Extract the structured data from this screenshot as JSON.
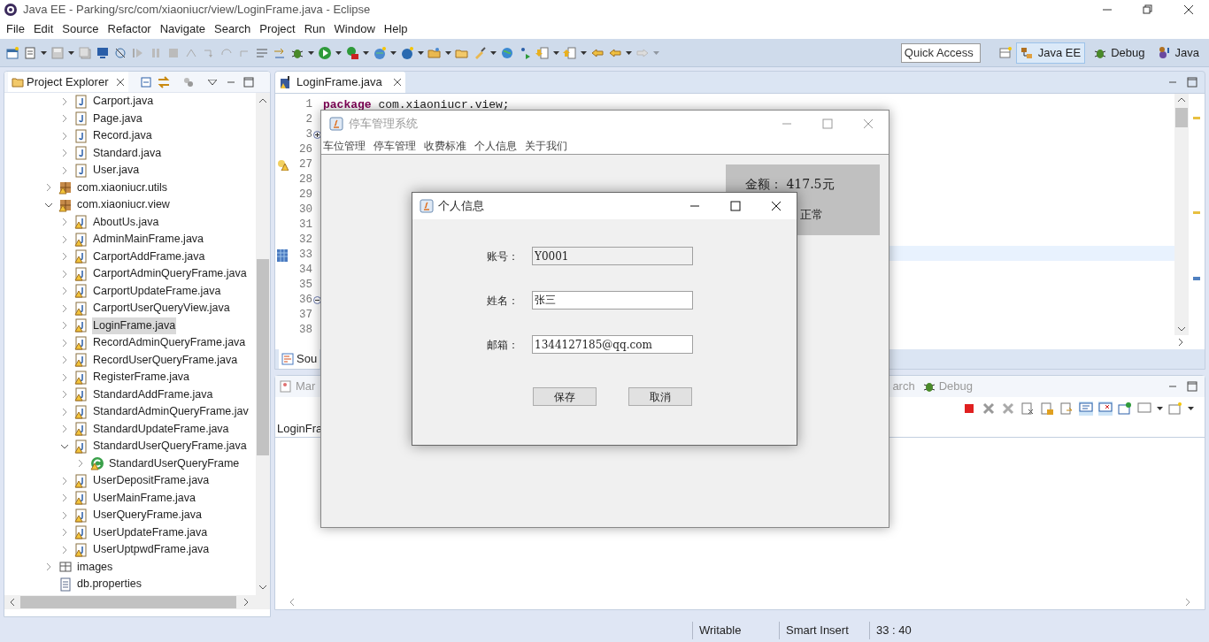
{
  "window": {
    "title": "Java EE - Parking/src/com/xiaoniucr/view/LoginFrame.java - Eclipse"
  },
  "menu_bar": [
    "File",
    "Edit",
    "Source",
    "Refactor",
    "Navigate",
    "Search",
    "Project",
    "Run",
    "Window",
    "Help"
  ],
  "toolbar": {
    "quick_access": {
      "placeholder": "Quick Access"
    },
    "perspectives": [
      {
        "label": "Java EE",
        "selected": true,
        "kind": "javaee"
      },
      {
        "label": "Debug",
        "selected": false,
        "kind": "debug"
      },
      {
        "label": "Java",
        "selected": false,
        "kind": "java"
      }
    ]
  },
  "project_explorer": {
    "title": "Project Explorer",
    "tree": [
      {
        "children": [
          {
            "label": "Carport.java",
            "kind": "java",
            "warning": false,
            "expanded": false,
            "selected": false
          },
          {
            "label": "Page.java",
            "kind": "java",
            "warning": false,
            "expanded": false,
            "selected": false
          },
          {
            "label": "Record.java",
            "kind": "java",
            "warning": false,
            "expanded": false,
            "selected": false
          },
          {
            "label": "Standard.java",
            "kind": "java",
            "warning": false,
            "expanded": false,
            "selected": false
          },
          {
            "label": "User.java",
            "kind": "java",
            "warning": false,
            "expanded": false,
            "selected": false
          }
        ]
      },
      {
        "label": "com.xiaoniucr.utils",
        "kind": "package",
        "warning": true,
        "expanded": false,
        "selected": false
      },
      {
        "label": "com.xiaoniucr.view",
        "kind": "package",
        "warning": true,
        "expanded": true,
        "selected": false,
        "children": [
          {
            "label": "AboutUs.java",
            "kind": "java",
            "warning": true,
            "expanded": false,
            "selected": false
          },
          {
            "label": "AdminMainFrame.java",
            "kind": "java",
            "warning": true,
            "expanded": false,
            "selected": false
          },
          {
            "label": "CarportAddFrame.java",
            "kind": "java",
            "warning": true,
            "expanded": false,
            "selected": false
          },
          {
            "label": "CarportAdminQueryFrame.java",
            "kind": "java",
            "warning": true,
            "expanded": false,
            "selected": false
          },
          {
            "label": "CarportUpdateFrame.java",
            "kind": "java",
            "warning": true,
            "expanded": false,
            "selected": false
          },
          {
            "label": "CarportUserQueryView.java",
            "kind": "java",
            "warning": true,
            "expanded": false,
            "selected": false
          },
          {
            "label": "LoginFrame.java",
            "kind": "java",
            "warning": true,
            "expanded": false,
            "selected": true
          },
          {
            "label": "RecordAdminQueryFrame.java",
            "kind": "java",
            "warning": true,
            "expanded": false,
            "selected": false
          },
          {
            "label": "RecordUserQueryFrame.java",
            "kind": "java",
            "warning": true,
            "expanded": false,
            "selected": false
          },
          {
            "label": "RegisterFrame.java",
            "kind": "java",
            "warning": true,
            "expanded": false,
            "selected": false
          },
          {
            "label": "StandardAddFrame.java",
            "kind": "java",
            "warning": true,
            "expanded": false,
            "selected": false
          },
          {
            "label": "StandardAdminQueryFrame.jav",
            "kind": "java",
            "warning": true,
            "expanded": false,
            "selected": false
          },
          {
            "label": "StandardUpdateFrame.java",
            "kind": "java",
            "warning": true,
            "expanded": false,
            "selected": false
          },
          {
            "label": "StandardUserQueryFrame.java",
            "kind": "java",
            "warning": true,
            "expanded": true,
            "selected": false,
            "children": [
              {
                "label": "StandardUserQueryFrame",
                "kind": "class",
                "warning": true,
                "expanded": false,
                "selected": false
              }
            ]
          },
          {
            "label": "UserDepositFrame.java",
            "kind": "java",
            "warning": true,
            "expanded": false,
            "selected": false
          },
          {
            "label": "UserMainFrame.java",
            "kind": "java",
            "warning": true,
            "expanded": false,
            "selected": false
          },
          {
            "label": "UserQueryFrame.java",
            "kind": "java",
            "warning": true,
            "expanded": false,
            "selected": false
          },
          {
            "label": "UserUpdateFrame.java",
            "kind": "java",
            "warning": true,
            "expanded": false,
            "selected": false
          },
          {
            "label": "UserUptpwdFrame.java",
            "kind": "java",
            "warning": true,
            "expanded": false,
            "selected": false
          }
        ]
      },
      {
        "label": "images",
        "kind": "folder",
        "warning": false,
        "expanded": false,
        "selected": false
      },
      {
        "label": "db.properties",
        "kind": "file",
        "warning": false,
        "selected": false
      }
    ]
  },
  "editor": {
    "tab": "LoginFrame.java",
    "lines": [
      {
        "number": "1",
        "code_keyword": "package",
        "code": " com.xiaoniucr.view;"
      },
      {
        "number": "2"
      },
      {
        "number": "3",
        "foldable": true,
        "folded": true
      },
      {
        "number": "26"
      },
      {
        "number": "27",
        "warning": true
      },
      {
        "number": "28"
      },
      {
        "number": "29"
      },
      {
        "number": "30"
      },
      {
        "number": "31"
      },
      {
        "number": "32"
      },
      {
        "number": "33",
        "task": true,
        "current": true
      },
      {
        "number": "34"
      },
      {
        "number": "35"
      },
      {
        "number": "36",
        "foldable": true,
        "folded": false
      },
      {
        "number": "37"
      },
      {
        "number": "38"
      }
    ],
    "bottom_tab": "Sou"
  },
  "bottom_panel": {
    "tabs": [
      {
        "label": "Mar",
        "kind": "markers"
      },
      {
        "label": "arch",
        "kind": "search"
      },
      {
        "label": "Debug",
        "kind": "debug"
      }
    ],
    "content": "LoginFra"
  },
  "main_frame": {
    "title": "停车管理系统",
    "menu": [
      "车位管理",
      "停车管理",
      "收费标准",
      "个人信息",
      "关于我们"
    ],
    "balance_panel": {
      "amount": "金额： 417.5元",
      "status": "正常"
    }
  },
  "dialog": {
    "title": "个人信息",
    "fields": [
      {
        "label": "账号：",
        "value": "Y0001",
        "disabled": true
      },
      {
        "label": "姓名：",
        "value": "张三",
        "disabled": false
      },
      {
        "label": "邮箱：",
        "value": "1344127185@qq.com",
        "disabled": false
      }
    ],
    "buttons": [
      "保存",
      "取消"
    ]
  },
  "status_bar": [
    "Writable",
    "Smart Insert",
    "33 : 40"
  ]
}
